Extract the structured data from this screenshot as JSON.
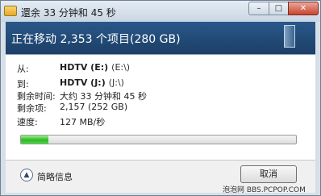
{
  "window": {
    "title": "還余 33 分钟和 45 秒",
    "buttons": {
      "minimize": "–",
      "maximize": "□",
      "close": "✕"
    }
  },
  "header": {
    "title": "正在移动 2,353 个项目(280 GB)"
  },
  "details": {
    "from_label": "从:",
    "from_name": "HDTV (E:)",
    "from_path": "(E:\\)",
    "to_label": "到:",
    "to_name": "HDTV (J:)",
    "to_path": "(J:\\)",
    "time_label": "剩余时间:",
    "time_value": "大约 33 分钟和 45 秒",
    "items_label": "剩余项:",
    "items_value": "2,157 (252 GB)",
    "speed_label": "速度:",
    "speed_value": "127 MB/秒"
  },
  "progress": {
    "percent": 10,
    "color": "#2fb829"
  },
  "footer": {
    "toggle_icon": "chevron-up-icon",
    "toggle_label": "简略信息",
    "cancel_label": "取消"
  },
  "watermark": "泡泡网 BBS.PCPOP.COM"
}
